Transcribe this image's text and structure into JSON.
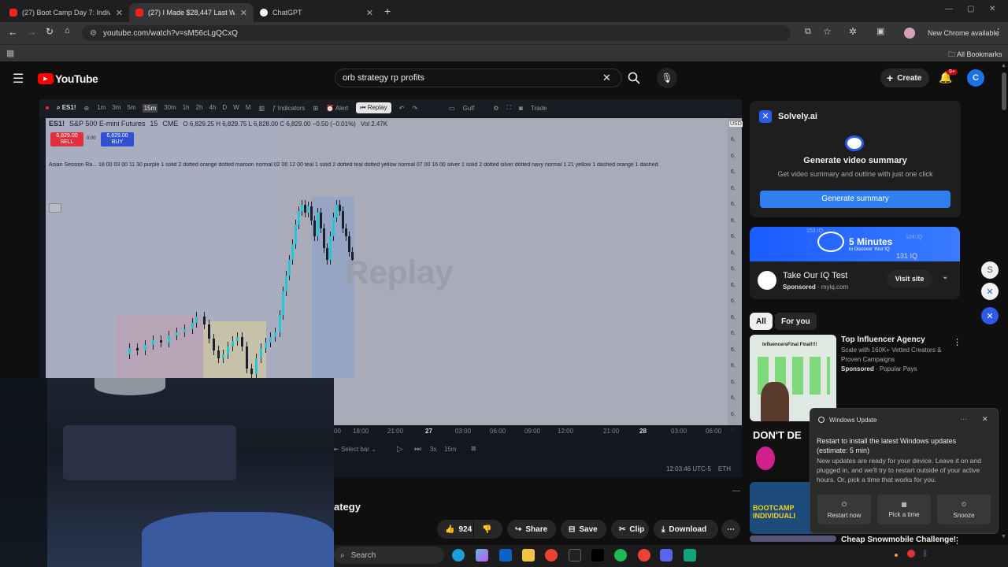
{
  "browser": {
    "tabs": [
      {
        "title": "(27) Boot Camp Day 7: Individu"
      },
      {
        "title": "(27) I Made $28,447 Last Week"
      },
      {
        "title": "ChatGPT"
      }
    ],
    "url": "youtube.com/watch?v=sM56cLgQCxQ",
    "new_chrome": "New Chrome available",
    "all_bookmarks": "All Bookmarks"
  },
  "youtube": {
    "logo": "YouTube",
    "search_query": "orb strategy rp profits",
    "create_label": "Create",
    "notif_count": "9+",
    "avatar_letter": "C"
  },
  "tradingview": {
    "symbol": "ES1!",
    "intervals": [
      "1m",
      "3m",
      "5m",
      "15m",
      "30m",
      "1h",
      "2h",
      "4h",
      "D",
      "W",
      "M"
    ],
    "indicators_label": "Indicators",
    "alert_label": "Alert",
    "replay_label": "Replay",
    "trade_label": "Trade",
    "gulf_label": "Gulf",
    "instrument": "S&P 500 E-mini Futures",
    "tf": "15",
    "exchange": "CME",
    "ohlc": "O 6,829.25  H 6,829.75  L 6,828.00  C 6,829.00  −0.50 (−0.01%)",
    "vol": "Vol 2.47K",
    "sell_price": "6,829.00",
    "sell_label": "SELL",
    "spread": "0.00",
    "buy_price": "6,829.00",
    "buy_label": "BUY",
    "session_line": "Asian Session Ra... 18 00 03 00 11 30 purple 1 solid 2 dotted orange dotted maroon normal 02 00 12 00 teal 1 solid 2 dotted teal dotted yellow normal 07 00 16 00 silver 1 solid 2 dotted silver dotted navy normal 1 21 yellow 1 dashed orange 1 dashed",
    "watermark": "Replay",
    "currency": "USD",
    "time_labels": [
      "18:00",
      "21:00",
      "27",
      "03:00",
      "06:00",
      "09:00",
      "12:00",
      "21:00",
      "28",
      "03:00",
      "06:00"
    ],
    "partial_time": "00",
    "select_bar": "Select bar",
    "speed": "3x",
    "replay_tf": "15m",
    "clock": "12:03:46 UTC-5",
    "session": "ETH"
  },
  "video": {
    "title_fragment": "ategy",
    "like_count": "924",
    "share": "Share",
    "save": "Save",
    "clip": "Clip",
    "download": "Download"
  },
  "solvely": {
    "brand": "Solvely.ai",
    "heading": "Generate video summary",
    "sub": "Get video summary and outline with just one click",
    "button": "Generate summary"
  },
  "ad": {
    "banner_big": "5 Minutes",
    "banner_small": "to Discover Your IQ",
    "banner_num1": "153 IQ",
    "banner_num2": "124 IQ",
    "banner_num3": "131 IQ",
    "title": "Take Our IQ Test",
    "sponsored": "Sponsored",
    "domain": "myiq.com",
    "visit": "Visit site"
  },
  "chips": [
    "All",
    "For you"
  ],
  "recs": [
    {
      "title": "Top Influencer Agency",
      "desc": "Scale with 160K+ Vetted Creators & Proven Campaigns",
      "sponsored": "Sponsored",
      "channel": "Popular Pays",
      "thumb_text": "InfluencersFinal Final!!!!"
    },
    {
      "thumb_text": "DON'T DE"
    },
    {
      "thumb_text": "BOOTCAMP INDIVIDUALI"
    },
    {
      "title": "Cheap Snowmobile Challenge!"
    }
  ],
  "windows_update": {
    "header": "Windows Update",
    "title": "Restart to install the latest Windows updates (estimate: 5 min)",
    "body": "New updates are ready for your device. Leave it on and plugged in, and we'll try to restart outside of your active hours. Or, pick a time that works for you.",
    "buttons": [
      "Restart now",
      "Pick a time",
      "Snooze"
    ]
  },
  "taskbar": {
    "search": "Search"
  },
  "colors": {
    "yt_red": "#ff0000",
    "blue": "#3ea6ff",
    "accent": "#2f7ff0",
    "candle": "#26c6da"
  }
}
